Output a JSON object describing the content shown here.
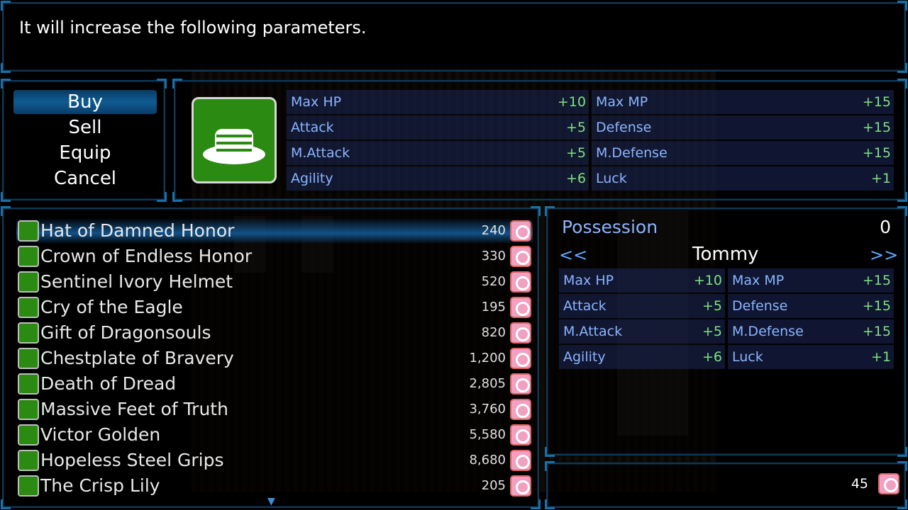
{
  "help": {
    "text": "It will increase the following parameters."
  },
  "commands": [
    {
      "label": "Buy",
      "selected": true
    },
    {
      "label": "Sell",
      "selected": false
    },
    {
      "label": "Equip",
      "selected": false
    },
    {
      "label": "Cancel",
      "selected": false
    }
  ],
  "detail": {
    "icon": "hat-icon",
    "left": [
      {
        "name": "Max HP",
        "value": "+10"
      },
      {
        "name": "Attack",
        "value": "+5"
      },
      {
        "name": "M.Attack",
        "value": "+5"
      },
      {
        "name": "Agility",
        "value": "+6"
      }
    ],
    "right": [
      {
        "name": "Max MP",
        "value": "+15"
      },
      {
        "name": "Defense",
        "value": "+15"
      },
      {
        "name": "M.Defense",
        "value": "+15"
      },
      {
        "name": "Luck",
        "value": "+1"
      }
    ]
  },
  "items": [
    {
      "name": "Hat of Damned Honor",
      "price": "240",
      "icon": "hat-icon",
      "selected": true
    },
    {
      "name": "Crown of Endless Honor",
      "price": "330",
      "icon": "crown-icon"
    },
    {
      "name": "Sentinel Ivory Helmet",
      "price": "520",
      "icon": "helmet-icon"
    },
    {
      "name": "Cry of the Eagle",
      "price": "195",
      "icon": "clothing-icon"
    },
    {
      "name": "Gift of Dragonsouls",
      "price": "820",
      "icon": "robe-icon"
    },
    {
      "name": "Chestplate of Bravery",
      "price": "1,200",
      "icon": "armor-icon"
    },
    {
      "name": "Death of Dread",
      "price": "2,805",
      "icon": "heavy-armor-icon"
    },
    {
      "name": "Massive Feet of Truth",
      "price": "3,760",
      "icon": "boots-icon"
    },
    {
      "name": "Victor Golden",
      "price": "5,580",
      "icon": "greaves-icon"
    },
    {
      "name": "Hopeless Steel Grips",
      "price": "8,680",
      "icon": "gauntlets-icon"
    },
    {
      "name": "The Crisp Lily",
      "price": "205",
      "icon": "accessory-icon"
    }
  ],
  "status": {
    "possession_label": "Possession",
    "possession_value": "0",
    "prev_arrow": "<<",
    "next_arrow": ">>",
    "actor": "Tommy",
    "left": [
      {
        "name": "Max HP",
        "value": "+10"
      },
      {
        "name": "Attack",
        "value": "+5"
      },
      {
        "name": "M.Attack",
        "value": "+5"
      },
      {
        "name": "Agility",
        "value": "+6"
      }
    ],
    "right": [
      {
        "name": "Max MP",
        "value": "+15"
      },
      {
        "name": "Defense",
        "value": "+15"
      },
      {
        "name": "M.Defense",
        "value": "+15"
      },
      {
        "name": "Luck",
        "value": "+1"
      }
    ]
  },
  "gold": {
    "value": "45",
    "icon": "currency-icon"
  },
  "colors": {
    "accent": "#0f5b93",
    "stat_label": "#8ab5ff",
    "stat_value": "#7fe07f",
    "coin": "#f0a0c0",
    "item_icon": "#2b8a12"
  }
}
